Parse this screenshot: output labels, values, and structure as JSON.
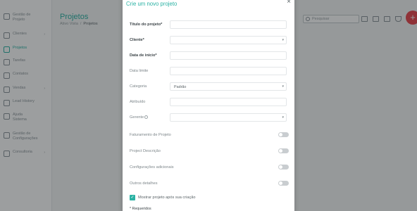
{
  "sidebar": {
    "items": [
      {
        "label": "Gestão de Projeto",
        "icon": "dashboard-icon"
      },
      {
        "label": "Clientes",
        "icon": "users-icon",
        "has_submenu": true
      },
      {
        "label": "Projetos",
        "icon": "folder-icon",
        "active": true
      },
      {
        "label": "Tarefas",
        "icon": "tasks-icon"
      },
      {
        "label": "Contatos",
        "icon": "phone-icon"
      },
      {
        "label": "Vendas",
        "icon": "cart-icon",
        "has_submenu": true
      },
      {
        "label": "Lead History",
        "icon": "history-icon"
      },
      {
        "label": "Ajuda Sistema",
        "icon": "help-icon"
      },
      {
        "label": "Gestão de Configurações",
        "icon": "settings-icon"
      },
      {
        "label": "Consultoria",
        "icon": "briefcase-icon",
        "has_submenu": true
      }
    ]
  },
  "header": {
    "title": "Projetos",
    "breadcrumb": [
      "Ativo Vista",
      "Projetos"
    ],
    "breadcrumb_sep": "/",
    "search_placeholder": "Pesquisar",
    "fab_label": "+"
  },
  "modal": {
    "title": "Crie um novo projeto",
    "close_label": "×",
    "fields": [
      {
        "label": "Título do projeto*",
        "required": true,
        "type": "text",
        "value": ""
      },
      {
        "label": "Cliente*",
        "required": true,
        "type": "select",
        "value": ""
      },
      {
        "label": "Data de início*",
        "required": true,
        "type": "text",
        "value": ""
      },
      {
        "label": "Data limite",
        "required": false,
        "type": "text",
        "value": ""
      },
      {
        "label": "Categoria",
        "required": false,
        "type": "select",
        "value": "Padrão"
      },
      {
        "label": "Atribuído",
        "required": false,
        "type": "text",
        "value": ""
      },
      {
        "label": "Gerente",
        "required": false,
        "type": "select",
        "value": "",
        "help": true
      }
    ],
    "toggles": [
      {
        "label": "Faturamento de Projeto",
        "on": false
      },
      {
        "label": "Project Descrição",
        "on": false
      },
      {
        "label": "Configurações adicionais",
        "on": false
      },
      {
        "label": "Outros detalhes",
        "on": false
      }
    ],
    "checkbox": {
      "label": "Mostrar projeto após sua criação",
      "checked": true,
      "mark": "✓"
    },
    "required_note": "* Requeridos",
    "caret": "▾"
  },
  "colors": {
    "accent": "#2bb2a4",
    "fab": "#e8454d",
    "overlay": "rgba(20,24,26,0.42)"
  }
}
